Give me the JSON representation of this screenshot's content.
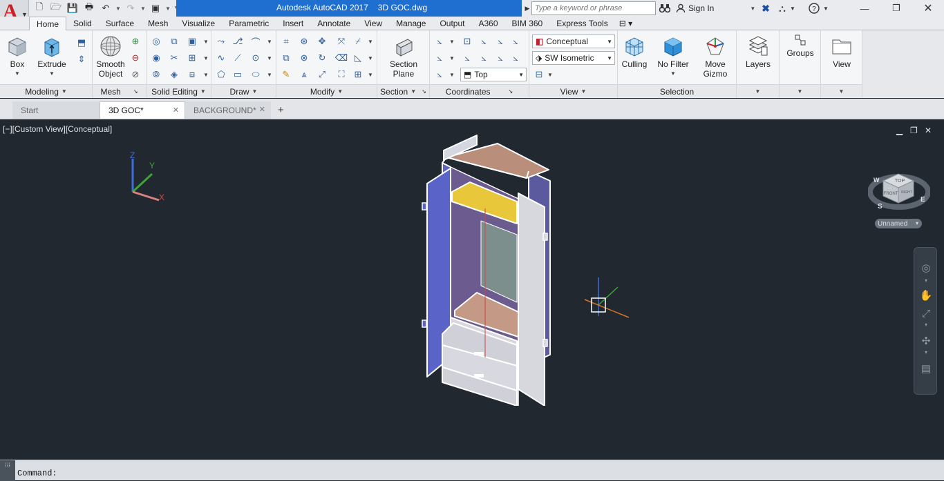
{
  "titlebar": {
    "app_name": "Autodesk AutoCAD 2017",
    "file_name": "3D GOC.dwg",
    "search_placeholder": "Type a keyword or phrase",
    "sign_in_label": "Sign In"
  },
  "ribbon_tabs": [
    "Home",
    "Solid",
    "Surface",
    "Mesh",
    "Visualize",
    "Parametric",
    "Insert",
    "Annotate",
    "View",
    "Manage",
    "Output",
    "A360",
    "BIM 360",
    "Express Tools"
  ],
  "active_tab": "Home",
  "panels": {
    "modeling": {
      "title": "Modeling",
      "box": "Box",
      "extrude": "Extrude"
    },
    "mesh": {
      "title": "Mesh",
      "smooth_line1": "Smooth",
      "smooth_line2": "Object"
    },
    "solid_editing": {
      "title": "Solid Editing"
    },
    "draw": {
      "title": "Draw"
    },
    "modify": {
      "title": "Modify"
    },
    "section": {
      "title": "Section",
      "plane_line1": "Section",
      "plane_line2": "Plane"
    },
    "coordinates": {
      "title": "Coordinates",
      "ucs_combo": "Top"
    },
    "view": {
      "title": "View",
      "visual_style": "Conceptual",
      "view_preset": "SW Isometric"
    },
    "selection": {
      "title": "Selection",
      "culling": "Culling",
      "no_filter": "No Filter",
      "gizmo_line1": "Move",
      "gizmo_line2": "Gizmo"
    },
    "layers": {
      "label": "Layers"
    },
    "groups": {
      "label": "Groups"
    },
    "view_big": {
      "label": "View"
    }
  },
  "file_tabs": [
    {
      "label": "Start"
    },
    {
      "label": "3D GOC*"
    },
    {
      "label": "BACKGROUND*"
    }
  ],
  "viewport": {
    "label": "[−][Custom View][Conceptual]",
    "ucs_z": "Z",
    "ucs_y": "Y",
    "ucs_x": "X",
    "viewcube_top": "TOP",
    "viewcube_front": "FRONT",
    "viewcube_right": "RIGHT",
    "compass_w": "W",
    "compass_s": "S",
    "compass_e": "E",
    "ucs_name": "Unnamed"
  },
  "command": {
    "prompt": "Command:"
  },
  "colors": {
    "title_blue": "#1e6fd0",
    "viewport_bg": "#212830",
    "wardrobe_blue": "#5a64c8",
    "wardrobe_tan": "#c79e86",
    "wardrobe_yellow": "#e8c73a"
  }
}
